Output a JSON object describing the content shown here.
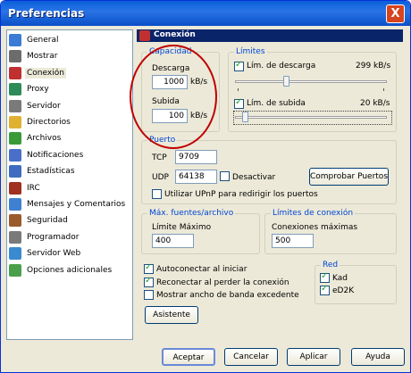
{
  "window": {
    "title": "Preferencias",
    "close": "X"
  },
  "sidebar": {
    "items": [
      {
        "label": "General",
        "icon": "general-icon",
        "color": "#3a7bd5"
      },
      {
        "label": "Mostrar",
        "icon": "display-icon",
        "color": "#6c6c6c"
      },
      {
        "label": "Conexión",
        "icon": "connection-icon",
        "color": "#c03030"
      },
      {
        "label": "Proxy",
        "icon": "proxy-icon",
        "color": "#2e8b57"
      },
      {
        "label": "Servidor",
        "icon": "server-icon",
        "color": "#7a7a7a"
      },
      {
        "label": "Directorios",
        "icon": "folder-icon",
        "color": "#e0b030"
      },
      {
        "label": "Archivos",
        "icon": "files-icon",
        "color": "#3a9a3a"
      },
      {
        "label": "Notificaciones",
        "icon": "notifications-icon",
        "color": "#4a6fc9"
      },
      {
        "label": "Estadísticas",
        "icon": "statistics-icon",
        "color": "#3f6cc0"
      },
      {
        "label": "IRC",
        "icon": "irc-icon",
        "color": "#a03020"
      },
      {
        "label": "Mensajes y Comentarios",
        "icon": "messages-icon",
        "color": "#4080d0"
      },
      {
        "label": "Seguridad",
        "icon": "security-icon",
        "color": "#9a5a2a"
      },
      {
        "label": "Programador",
        "icon": "scheduler-icon",
        "color": "#7a7a7a"
      },
      {
        "label": "Servidor Web",
        "icon": "webserver-icon",
        "color": "#3a8ad0"
      },
      {
        "label": "Opciones adicionales",
        "icon": "extra-options-icon",
        "color": "#4aa04a"
      }
    ],
    "selected": "Conexión"
  },
  "header": {
    "title": "Conexión"
  },
  "capacidad": {
    "title": "Capacidad",
    "descarga_label": "Descarga",
    "descarga_value": "1000",
    "descarga_unit": "kB/s",
    "subida_label": "Subida",
    "subida_value": "100",
    "subida_unit": "kB/s"
  },
  "limites": {
    "title": "Límites",
    "descarga_label": "Lím. de descarga",
    "descarga_value": "299 kB/s",
    "descarga_checked": true,
    "subida_label": "Lím. de subida",
    "subida_value": "20 kB/s",
    "subida_checked": true,
    "descarga_level": 0.33,
    "subida_level": 0.05
  },
  "puerto": {
    "title": "Puerto",
    "tcp_label": "TCP",
    "tcp_value": "9709",
    "udp_label": "UDP",
    "udp_value": "64138",
    "desactivar_label": "Desactivar",
    "desactivar_checked": false,
    "check_button": "Comprobar Puertos",
    "upnp_label": "Utilizar UPnP para redirigir los puertos",
    "upnp_checked": false
  },
  "fuentes": {
    "title": "Máx. fuentes/archivo",
    "limite_label": "Límite Máximo",
    "limite_value": "400"
  },
  "conexion_limites": {
    "title": "Límites de conexión",
    "max_label": "Conexiones máximas",
    "max_value": "500"
  },
  "opciones": {
    "autoconectar_label": "Autoconectar al iniciar",
    "autoconectar_checked": true,
    "reconectar_label": "Reconectar al perder la conexión",
    "reconectar_checked": true,
    "mostrar_label": "Mostrar ancho de banda excedente",
    "mostrar_checked": false,
    "asistente_button": "Asistente"
  },
  "red": {
    "title": "Red",
    "kad_label": "Kad",
    "kad_checked": true,
    "ed2k_label": "eD2K",
    "ed2k_checked": true
  },
  "footer": {
    "aceptar": "Aceptar",
    "cancelar": "Cancelar",
    "aplicar": "Aplicar",
    "ayuda": "Ayuda"
  }
}
